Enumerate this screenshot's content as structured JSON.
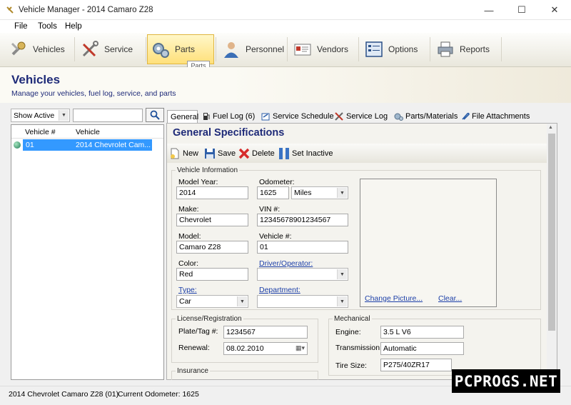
{
  "window": {
    "title": "Vehicle Manager - 2014 Camaro Z28",
    "min": "—",
    "max": "☐",
    "close": "✕"
  },
  "menu": [
    "File",
    "Tools",
    "Help"
  ],
  "toolbar": {
    "items": [
      {
        "label": "Vehicles",
        "icon": "wrench-key-icon"
      },
      {
        "label": "Service",
        "icon": "tools-icon"
      },
      {
        "label": "Parts",
        "icon": "gears-icon"
      },
      {
        "label": "Personnel",
        "icon": "person-icon"
      },
      {
        "label": "Vendors",
        "icon": "vendor-card-icon"
      },
      {
        "label": "Options",
        "icon": "options-icon"
      },
      {
        "label": "Reports",
        "icon": "printer-icon"
      }
    ],
    "active": "Parts",
    "tooltip": "Parts"
  },
  "header": {
    "title": "Vehicles",
    "subtitle": "Manage your vehicles, fuel log, service, and parts"
  },
  "filter": {
    "value": "Show Active",
    "search_value": ""
  },
  "list": {
    "columns": [
      "Vehicle #",
      "Vehicle"
    ],
    "rows": [
      {
        "num": "01",
        "name": "2014 Chevrolet Cam..."
      }
    ]
  },
  "tabs": [
    "General",
    "Fuel Log (6)",
    "Service Schedule",
    "Service Log",
    "Parts/Materials",
    "File Attachments"
  ],
  "general": {
    "title": "General Specifications",
    "actions": {
      "new": "New",
      "save": "Save",
      "delete": "Delete",
      "inactive": "Set Inactive"
    },
    "vehicle_info": {
      "legend": "Vehicle Information",
      "model_year_label": "Model Year:",
      "model_year": "2014",
      "odometer_label": "Odometer:",
      "odometer": "1625",
      "odometer_unit": "Miles",
      "make_label": "Make:",
      "make": "Chevrolet",
      "vin_label": "VIN #:",
      "vin": "12345678901234567",
      "model_label": "Model:",
      "model": "Camaro Z28",
      "vehicle_num_label": "Vehicle #:",
      "vehicle_num": "01",
      "color_label": "Color:",
      "color": "Red",
      "driver_label": "Driver/Operator:",
      "driver": "",
      "type_label": "Type:",
      "type": "Car",
      "department_label": "Department:",
      "department": ""
    },
    "picture": {
      "change": "Change Picture...",
      "clear": "Clear..."
    },
    "license": {
      "legend": "License/Registration",
      "plate_label": "Plate/Tag #:",
      "plate": "1234567",
      "renewal_label": "Renewal:",
      "renewal": "08.02.2010"
    },
    "mechanical": {
      "legend": "Mechanical",
      "engine_label": "Engine:",
      "engine": "3.5 L V6",
      "transmission_label": "Transmission:",
      "transmission": "Automatic",
      "tire_label": "Tire Size:",
      "tire": "P275/40ZR17"
    },
    "insurance": {
      "legend": "Insurance"
    }
  },
  "status": {
    "vehicle": "2014 Chevrolet Camaro Z28 (01)",
    "odometer": "Current Odometer: 1625"
  },
  "watermark": "PCPROGS.NET",
  "colors": {
    "title_blue": "#1e2a78",
    "selection": "#3399ff",
    "active_button": "#ffe07a",
    "link": "#1c3fa8"
  }
}
